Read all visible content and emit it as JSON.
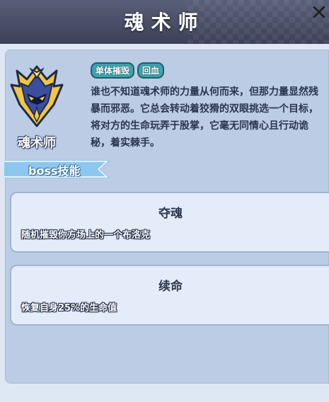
{
  "header": {
    "title": "魂术师"
  },
  "boss": {
    "name": "魂术师",
    "tags": [
      "单体摧毁",
      "回血"
    ],
    "description": "谁也不知道魂术师的力量从何而来，但那力量显然残暴而邪恶。它总会转动着狡猾的双眼挑选一个目标，将对方的生命玩弄于股掌，它毫无同情心且行动诡秘，着实棘手。"
  },
  "section": {
    "label": "boss技能"
  },
  "skills": [
    {
      "name": "夺魂",
      "effect": "随机摧毁你方场上的一个布洛克"
    },
    {
      "name": "续命",
      "effect": "恢复自身25%的生命值"
    }
  ],
  "colors": {
    "header_bg": "#3c4057",
    "panel_bg": "#bccce4",
    "tag_bg": "#3fa3b0",
    "card_bg": "#e4ecfa",
    "section_tab": "#8ec7ee"
  }
}
